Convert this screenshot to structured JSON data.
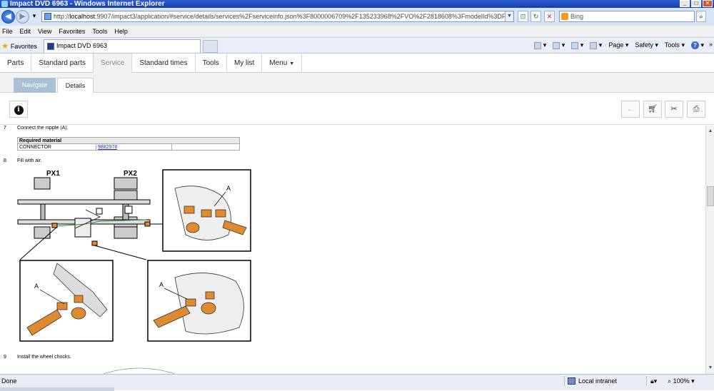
{
  "window": {
    "title": "Impact DVD 6963 - Windows Internet Explorer"
  },
  "address": {
    "url_prefix": "http://",
    "host": "localhost",
    "url_rest": ":9907/impact3/application/#service/details/services%2Fserviceinfo.json%3F8000006709%2F135233968%2FVO%2F2818608%3FmodelId%3DFM%20(4)"
  },
  "search": {
    "placeholder": "Bing"
  },
  "menu": [
    "File",
    "Edit",
    "View",
    "Favorites",
    "Tools",
    "Help"
  ],
  "favorites": {
    "label": "Favorites",
    "tab_title": "Impact DVD 6963",
    "tools": [
      "Page",
      "Safety",
      "Tools"
    ]
  },
  "app_tabs": [
    "Parts",
    "Standard parts",
    "Service",
    "Standard times",
    "Tools",
    "My list",
    "Menu"
  ],
  "active_tab": "Service",
  "sub_tabs": {
    "navigate": "Navigate",
    "details": "Details"
  },
  "doc": {
    "step7": {
      "num": "7",
      "text": "Connect the nipple (A)."
    },
    "material": {
      "header": "Required material",
      "part": "CONNECTOR",
      "number": "9882978"
    },
    "step8": {
      "num": "8",
      "text": "Fill with air."
    },
    "step9": {
      "num": "9",
      "text": "Install the wheel chocks."
    },
    "figure": {
      "px1": "PX1",
      "px2": "PX2",
      "callout": "A"
    }
  },
  "status": {
    "left": "Done",
    "zone": "Local intranet",
    "zoom": "100%"
  },
  "colors": {
    "title_bar": "#1941a5",
    "tab_bg": "#f2f2f2",
    "nav_tab": "#a8bfd5",
    "link": "#2030c0",
    "orange": "#e08a30"
  }
}
